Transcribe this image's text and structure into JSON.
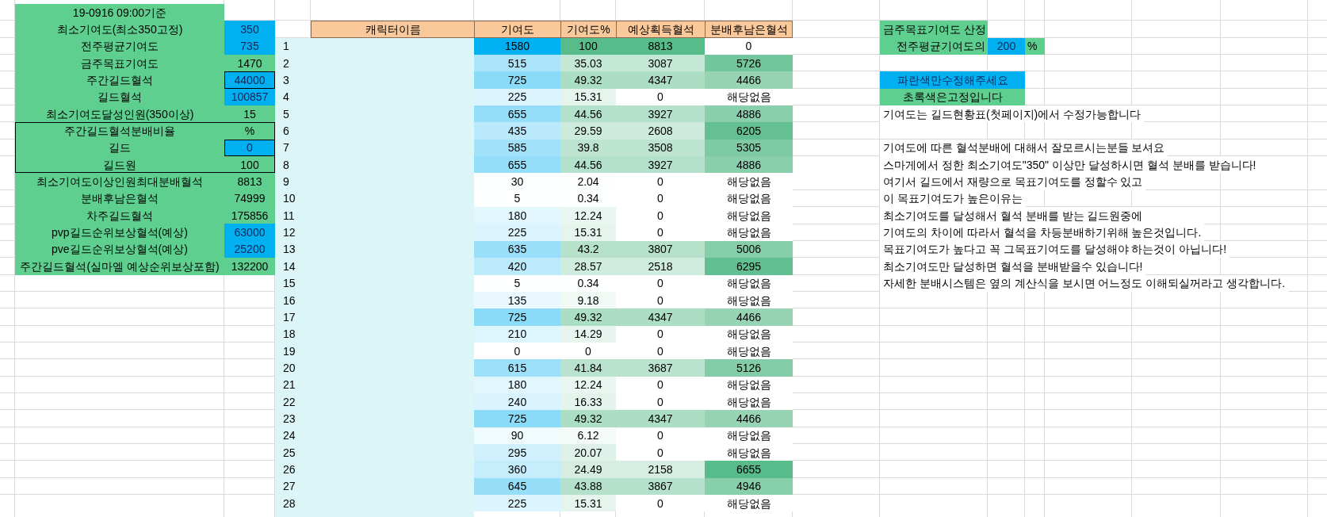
{
  "left_panel": {
    "title": "19-0916 09:00기준",
    "sections": [
      {
        "boxed": false,
        "rows": [
          {
            "label": "최소기여도(최소350고정)",
            "value": "350",
            "editable": true,
            "outlined": false
          },
          {
            "label": "전주평균기여도",
            "value": "735",
            "editable": true,
            "outlined": false
          },
          {
            "label": "금주목표기여도",
            "value": "1470",
            "editable": false,
            "outlined": false
          },
          {
            "label": "주간길드혈석",
            "value": "44000",
            "editable": true,
            "outlined": true
          },
          {
            "label": "길드혈석",
            "value": "100857",
            "editable": true,
            "outlined": false
          },
          {
            "label": "최소기여도달성인원(350이상)",
            "value": "15",
            "editable": false,
            "outlined": false
          }
        ]
      },
      {
        "boxed": true,
        "rows": [
          {
            "label": "주간길드혈석분배비율",
            "value": "%",
            "editable": false,
            "outlined": false
          },
          {
            "label": "길드",
            "value": "0",
            "editable": true,
            "outlined": true
          },
          {
            "label": "길드원",
            "value": "100",
            "editable": false,
            "outlined": false
          }
        ]
      },
      {
        "boxed": false,
        "rows": [
          {
            "label": "최소기여도이상인원최대분배혈석",
            "value": "8813",
            "editable": false,
            "outlined": false
          },
          {
            "label": "분배후남은혈석",
            "value": "74999",
            "editable": false,
            "outlined": false
          },
          {
            "label": "차주길드혈석",
            "value": "175856",
            "editable": false,
            "outlined": false
          },
          {
            "label": "pvp길드순위보상혈석(예상)",
            "value": "63000",
            "editable": true,
            "outlined": false
          },
          {
            "label": "pve길드순위보상혈석(예상)",
            "value": "25200",
            "editable": true,
            "outlined": false
          },
          {
            "label": "주간길드혈석(실마엘 예상순위보상포함)",
            "value": "132200",
            "editable": false,
            "outlined": false
          }
        ]
      }
    ]
  },
  "table": {
    "columns": [
      "캐릭터이름",
      "기여도",
      "기여도%",
      "예상획득혈석",
      "분배후남은혈석"
    ],
    "rows": [
      {
        "no": "1",
        "contribution": "1580",
        "percent": "100",
        "expected": "8813",
        "remaining": "0"
      },
      {
        "no": "2",
        "contribution": "515",
        "percent": "35.03",
        "expected": "3087",
        "remaining": "5726"
      },
      {
        "no": "3",
        "contribution": "725",
        "percent": "49.32",
        "expected": "4347",
        "remaining": "4466"
      },
      {
        "no": "4",
        "contribution": "225",
        "percent": "15.31",
        "expected": "0",
        "remaining": "해당없음"
      },
      {
        "no": "5",
        "contribution": "655",
        "percent": "44.56",
        "expected": "3927",
        "remaining": "4886"
      },
      {
        "no": "6",
        "contribution": "435",
        "percent": "29.59",
        "expected": "2608",
        "remaining": "6205"
      },
      {
        "no": "7",
        "contribution": "585",
        "percent": "39.8",
        "expected": "3508",
        "remaining": "5305"
      },
      {
        "no": "8",
        "contribution": "655",
        "percent": "44.56",
        "expected": "3927",
        "remaining": "4886"
      },
      {
        "no": "9",
        "contribution": "30",
        "percent": "2.04",
        "expected": "0",
        "remaining": "해당없음"
      },
      {
        "no": "10",
        "contribution": "5",
        "percent": "0.34",
        "expected": "0",
        "remaining": "해당없음"
      },
      {
        "no": "11",
        "contribution": "180",
        "percent": "12.24",
        "expected": "0",
        "remaining": "해당없음"
      },
      {
        "no": "12",
        "contribution": "225",
        "percent": "15.31",
        "expected": "0",
        "remaining": "해당없음"
      },
      {
        "no": "13",
        "contribution": "635",
        "percent": "43.2",
        "expected": "3807",
        "remaining": "5006"
      },
      {
        "no": "14",
        "contribution": "420",
        "percent": "28.57",
        "expected": "2518",
        "remaining": "6295"
      },
      {
        "no": "15",
        "contribution": "5",
        "percent": "0.34",
        "expected": "0",
        "remaining": "해당없음"
      },
      {
        "no": "16",
        "contribution": "135",
        "percent": "9.18",
        "expected": "0",
        "remaining": "해당없음"
      },
      {
        "no": "17",
        "contribution": "725",
        "percent": "49.32",
        "expected": "4347",
        "remaining": "4466"
      },
      {
        "no": "18",
        "contribution": "210",
        "percent": "14.29",
        "expected": "0",
        "remaining": "해당없음"
      },
      {
        "no": "19",
        "contribution": "0",
        "percent": "0",
        "expected": "0",
        "remaining": "해당없음"
      },
      {
        "no": "20",
        "contribution": "615",
        "percent": "41.84",
        "expected": "3687",
        "remaining": "5126"
      },
      {
        "no": "21",
        "contribution": "180",
        "percent": "12.24",
        "expected": "0",
        "remaining": "해당없음"
      },
      {
        "no": "22",
        "contribution": "240",
        "percent": "16.33",
        "expected": "0",
        "remaining": "해당없음"
      },
      {
        "no": "23",
        "contribution": "725",
        "percent": "49.32",
        "expected": "4347",
        "remaining": "4466"
      },
      {
        "no": "24",
        "contribution": "90",
        "percent": "6.12",
        "expected": "0",
        "remaining": "해당없음"
      },
      {
        "no": "25",
        "contribution": "295",
        "percent": "20.07",
        "expected": "0",
        "remaining": "해당없음"
      },
      {
        "no": "26",
        "contribution": "360",
        "percent": "24.49",
        "expected": "2158",
        "remaining": "6655"
      },
      {
        "no": "27",
        "contribution": "645",
        "percent": "43.88",
        "expected": "3867",
        "remaining": "4946"
      },
      {
        "no": "28",
        "contribution": "225",
        "percent": "15.31",
        "expected": "0",
        "remaining": "해당없음"
      }
    ]
  },
  "right_panel": {
    "heading": "금주목표기여도 산정",
    "target": {
      "label": "전주평균기여도의",
      "value": "200",
      "unit": "%"
    },
    "legend": [
      {
        "text": "파란색만수정해주세요",
        "kind": "editable"
      },
      {
        "text": "초록색은고정입니다",
        "kind": "fixed"
      }
    ],
    "edit_note": "기여도는 길드현황표(첫페이지)에서 수정가능합니다",
    "explanation": [
      "기여도에 따른 혈석분배에 대해서 잘모르시는분들 보셔요",
      "스마게에서 정한 최소기여도\"350\" 이상만 달성하시면 혈석 분배를 받습니다!",
      "여기서 길드에서 재량으로 목표기여도를 정할수 있고",
      "이 목표기여도가 높은이유는",
      "최소기여도를 달성해서 혈석 분배를 받는 길드원중에",
      "기여도의 차이에 따라서 혈석을 차등분배하기위해 높은것입니다.",
      "목표기여도가 높다고 꼭 그목표기여도를 달성해야 하는것이 아닙니다!",
      "최소기여도만 달성하면 혈석을 분배받을수 있습니다!",
      "자세한 분배시스템은 옆의 계산식을 보시면 어느정도 이해되실꺼라고 생각합니다."
    ]
  }
}
